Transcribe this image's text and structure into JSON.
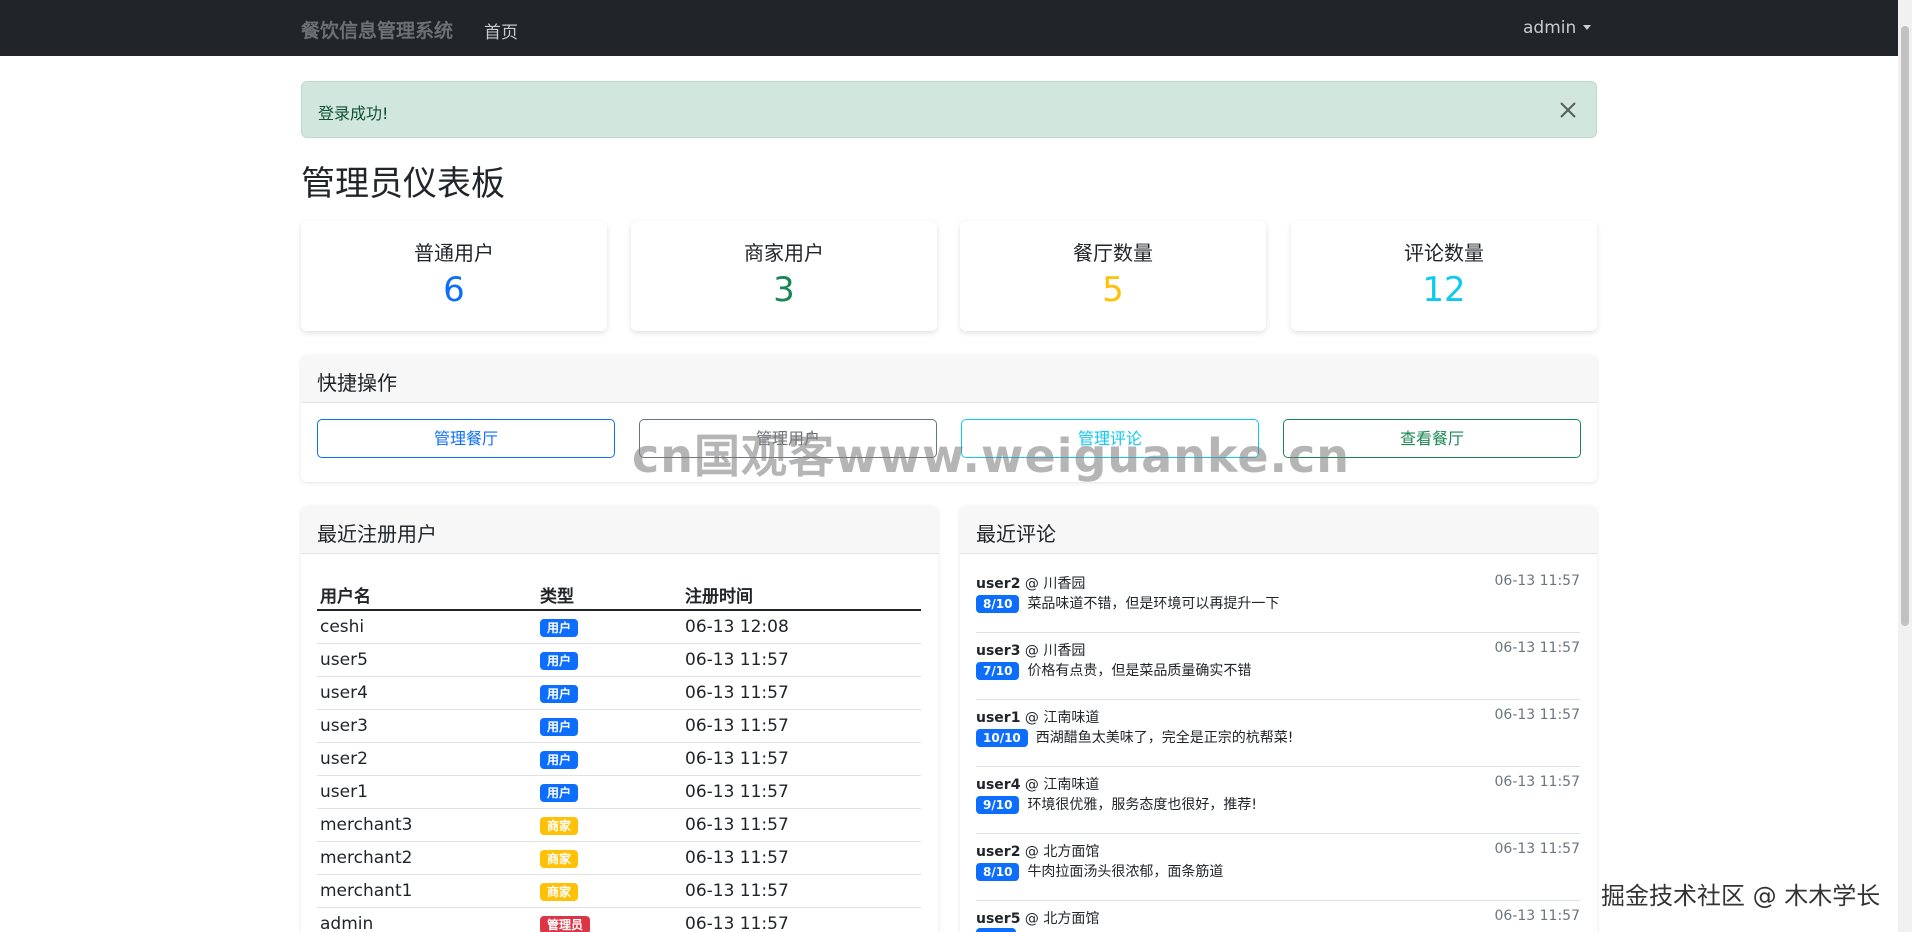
{
  "navbar": {
    "brand": "餐饮信息管理系统",
    "home": "首页",
    "user": "admin"
  },
  "alert": {
    "message": "登录成功!"
  },
  "page_title": "管理员仪表板",
  "stats": [
    {
      "label": "普通用户",
      "value": "6",
      "color": "#0d6efd"
    },
    {
      "label": "商家用户",
      "value": "3",
      "color": "#198754"
    },
    {
      "label": "餐厅数量",
      "value": "5",
      "color": "#ffc107"
    },
    {
      "label": "评论数量",
      "value": "12",
      "color": "#0dcaf0"
    }
  ],
  "quick_actions": {
    "title": "快捷操作",
    "buttons": [
      {
        "label": "管理餐厅",
        "color": "#0d6efd"
      },
      {
        "label": "管理用户",
        "color": "#6c757d"
      },
      {
        "label": "管理评论",
        "color": "#0dcaf0"
      },
      {
        "label": "查看餐厅",
        "color": "#198754"
      }
    ]
  },
  "recent_users": {
    "title": "最近注册用户",
    "headers": [
      "用户名",
      "类型",
      "注册时间"
    ],
    "rows": [
      {
        "name": "ceshi",
        "type": "用户",
        "type_color": "#0d6efd",
        "time": "06-13 12:08"
      },
      {
        "name": "user5",
        "type": "用户",
        "type_color": "#0d6efd",
        "time": "06-13 11:57"
      },
      {
        "name": "user4",
        "type": "用户",
        "type_color": "#0d6efd",
        "time": "06-13 11:57"
      },
      {
        "name": "user3",
        "type": "用户",
        "type_color": "#0d6efd",
        "time": "06-13 11:57"
      },
      {
        "name": "user2",
        "type": "用户",
        "type_color": "#0d6efd",
        "time": "06-13 11:57"
      },
      {
        "name": "user1",
        "type": "用户",
        "type_color": "#0d6efd",
        "time": "06-13 11:57"
      },
      {
        "name": "merchant3",
        "type": "商家",
        "type_color": "#ffc107",
        "time": "06-13 11:57"
      },
      {
        "name": "merchant2",
        "type": "商家",
        "type_color": "#ffc107",
        "time": "06-13 11:57"
      },
      {
        "name": "merchant1",
        "type": "商家",
        "type_color": "#ffc107",
        "time": "06-13 11:57"
      },
      {
        "name": "admin",
        "type": "管理员",
        "type_color": "#dc3545",
        "time": "06-13 11:57"
      }
    ]
  },
  "recent_reviews": {
    "title": "最近评论",
    "items": [
      {
        "user": "user2",
        "restaurant": "川香园",
        "time": "06-13 11:57",
        "score": "8/10",
        "text": "菜品味道不错，但是环境可以再提升一下"
      },
      {
        "user": "user3",
        "restaurant": "川香园",
        "time": "06-13 11:57",
        "score": "7/10",
        "text": "价格有点贵，但是菜品质量确实不错"
      },
      {
        "user": "user1",
        "restaurant": "江南味道",
        "time": "06-13 11:57",
        "score": "10/10",
        "text": "西湖醋鱼太美味了，完全是正宗的杭帮菜!"
      },
      {
        "user": "user4",
        "restaurant": "江南味道",
        "time": "06-13 11:57",
        "score": "9/10",
        "text": "环境很优雅，服务态度也很好，推荐!"
      },
      {
        "user": "user2",
        "restaurant": "北方面馆",
        "time": "06-13 11:57",
        "score": "8/10",
        "text": "牛肉拉面汤头很浓郁，面条筋道"
      },
      {
        "user": "user5",
        "restaurant": "北方面馆",
        "time": "06-13 11:57",
        "score": "",
        "text": ""
      }
    ]
  },
  "watermarks": {
    "center": "cn国观客www.weiguanke.cn",
    "corner": "掘金技术社区 @ 木木学长"
  }
}
